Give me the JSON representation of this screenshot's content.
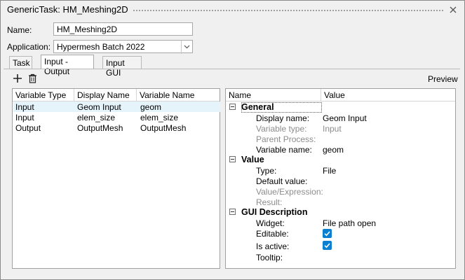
{
  "window": {
    "title": "GenericTask: HM_Meshing2D"
  },
  "form": {
    "name_label": "Name:",
    "name_value": "HM_Meshing2D",
    "application_label": "Application:",
    "application_value": "Hypermesh Batch 2022"
  },
  "tabs": [
    {
      "label": "Task"
    },
    {
      "label": "Input - Output"
    },
    {
      "label": "Input GUI"
    }
  ],
  "toolbar": {
    "preview_label": "Preview"
  },
  "variables": {
    "columns": [
      "Variable Type",
      "Display Name",
      "Variable Name"
    ],
    "rows": [
      [
        "Input",
        "Geom Input",
        "geom"
      ],
      [
        "Input",
        "elem_size",
        "elem_size"
      ],
      [
        "Output",
        "OutputMesh",
        "OutputMesh"
      ]
    ]
  },
  "properties": {
    "columns": [
      "Name",
      "Value"
    ],
    "groups": [
      {
        "title": "General",
        "props": [
          {
            "name": "Display name:",
            "value": "Geom Input"
          },
          {
            "name": "Variable type:",
            "value": "Input"
          },
          {
            "name": "Parent Process:",
            "value": ""
          },
          {
            "name": "Variable name:",
            "value": "geom"
          }
        ]
      },
      {
        "title": "Value",
        "props": [
          {
            "name": "Type:",
            "value": "File"
          },
          {
            "name": "Default value:",
            "value": ""
          },
          {
            "name": "Value/Expression:",
            "value": ""
          },
          {
            "name": "Result:",
            "value": ""
          }
        ]
      },
      {
        "title": "GUI Description",
        "props": [
          {
            "name": "Widget:",
            "value": "File path open"
          },
          {
            "name": "Editable:",
            "value": ""
          },
          {
            "name": "Is active:",
            "value": ""
          },
          {
            "name": "Tooltip:",
            "value": ""
          }
        ]
      }
    ]
  },
  "colors": {
    "accent": "#0a7fd1",
    "selection": "#e5f3fb"
  }
}
